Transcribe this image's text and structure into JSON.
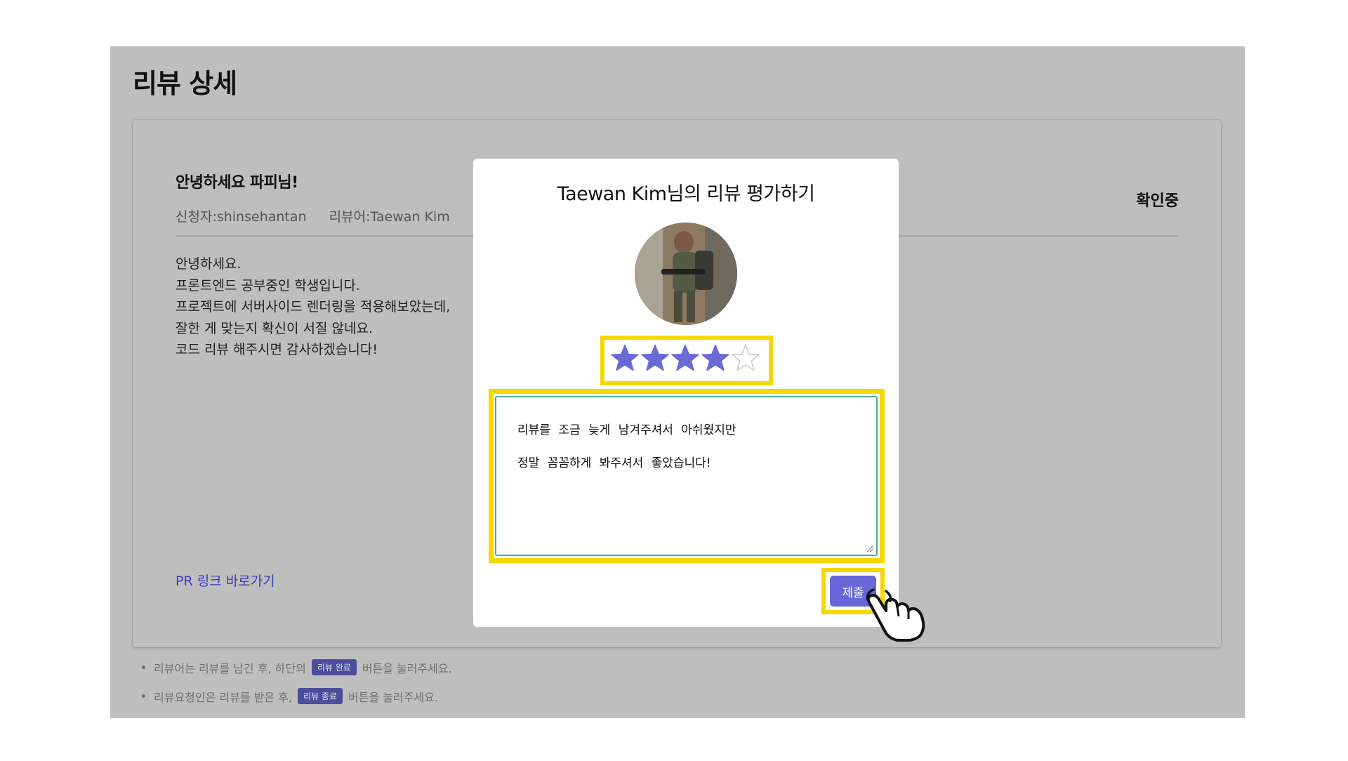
{
  "page": {
    "title": "리뷰 상세"
  },
  "card": {
    "heading": "안녕하세요 파피님!",
    "requester": "신청자:shinsehantan",
    "reviewer": "리뷰어:Taewan Kim",
    "status": "확인중",
    "body_lines": [
      "안녕하세요.",
      "프론트엔드 공부중인 학생입니다.",
      "프로젝트에 서버사이드 렌더링을 적용해보았는데,",
      "잘한 게 맞는지 확신이 서질 않네요.",
      "코드 리뷰 해주시면 감사하겠습니다!"
    ],
    "pr_link": "PR 링크 바로가기"
  },
  "notes": [
    {
      "before": "리뷰어는 리뷰를 남긴 후, 하단의",
      "chip": "리뷰 완료",
      "after": "버튼을 눌러주세요."
    },
    {
      "before": "리뷰요청인은 리뷰를 받은 후,",
      "chip": "리뷰 종료",
      "after": "버튼을 눌러주세요."
    }
  ],
  "modal": {
    "title": "Taewan Kim님의 리뷰 평가하기",
    "rating": {
      "value": 4,
      "max": 5
    },
    "review_lines": [
      "리뷰를 조금 늦게 남겨주셔서 아쉬웠지만",
      "정말 꼼꼼하게 봐주셔서 좋았습니다!"
    ],
    "submit_label": "제출"
  },
  "colors": {
    "overlay_bg": "#bebebe",
    "star_filled": "#6a6ad4",
    "submit_bg": "#6767d8",
    "highlight": "#f5d800",
    "textarea_border": "#4caf8f",
    "chip_bg": "#4d4d9e",
    "link": "#3d3dba"
  },
  "icons": {
    "star": "star-icon",
    "pointer": "hand-pointer-icon",
    "avatar": "avatar"
  }
}
